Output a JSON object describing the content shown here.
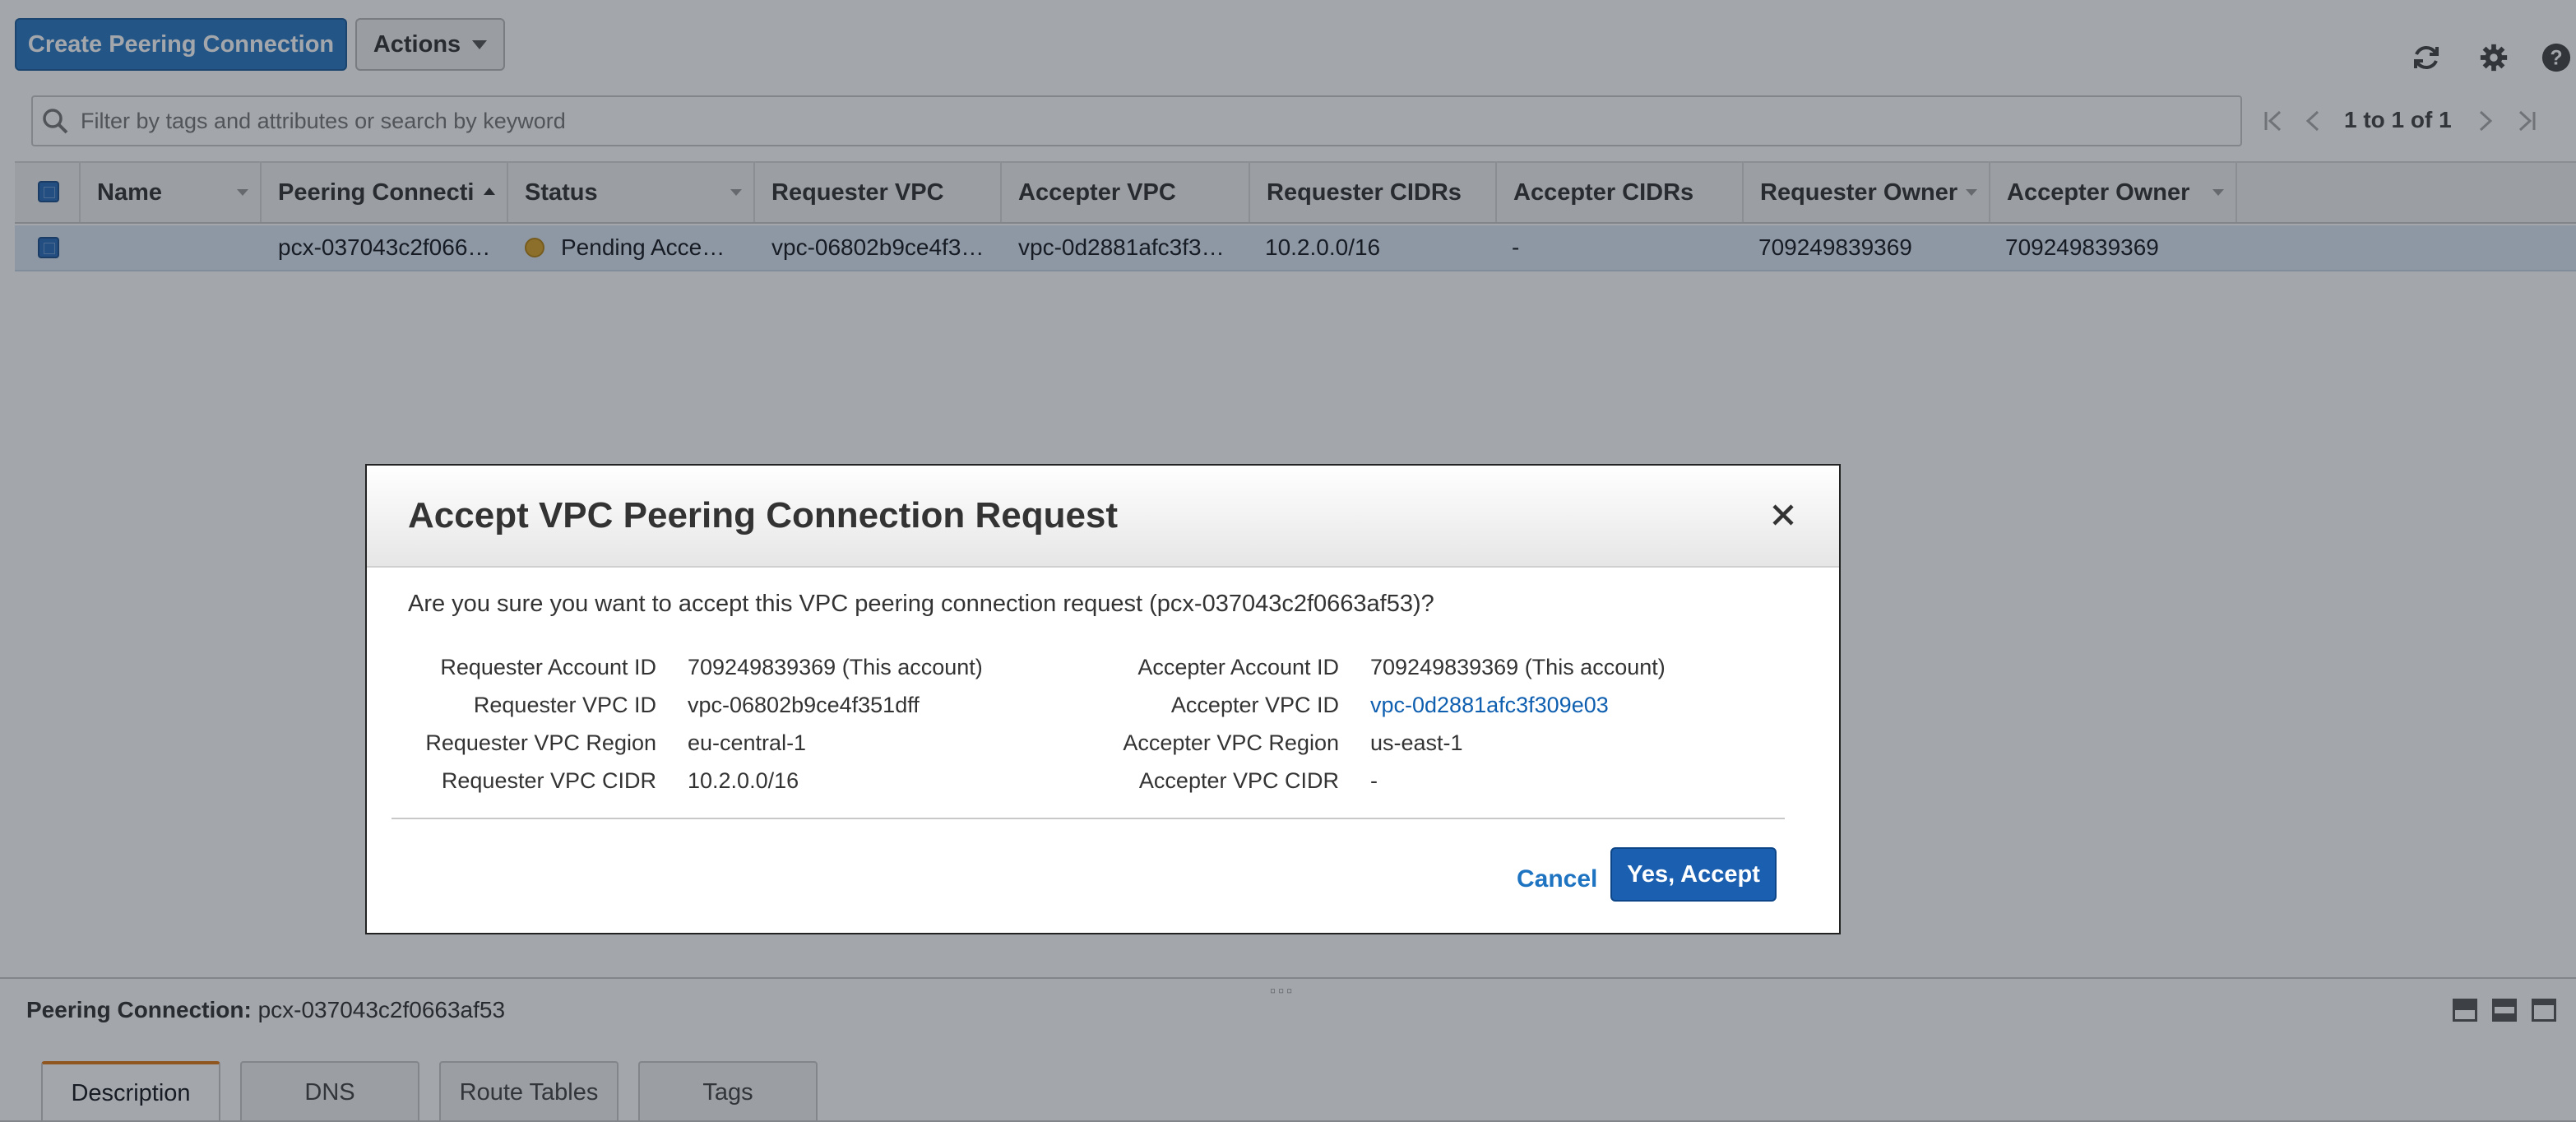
{
  "toolbar": {
    "create_label": "Create Peering Connection",
    "actions_label": "Actions"
  },
  "search": {
    "placeholder": "Filter by tags and attributes or search by keyword",
    "value": ""
  },
  "pagination": {
    "text": "1 to 1 of 1"
  },
  "table": {
    "columns": [
      "Name",
      "Peering Connecti",
      "Status",
      "Requester VPC",
      "Accepter VPC",
      "Requester CIDRs",
      "Accepter CIDRs",
      "Requester Owner",
      "Accepter Owner"
    ],
    "rows": [
      {
        "name": "",
        "peering_connection": "pcx-037043c2f066…",
        "status": "Pending Acce…",
        "requester_vpc": "vpc-06802b9ce4f3…",
        "accepter_vpc": "vpc-0d2881afc3f3…",
        "requester_cidrs": "10.2.0.0/16",
        "accepter_cidrs": "-",
        "requester_owner": "709249839369",
        "accepter_owner": "709249839369"
      }
    ]
  },
  "detail": {
    "label": "Peering Connection:",
    "value": "pcx-037043c2f0663af53",
    "tabs": [
      "Description",
      "DNS",
      "Route Tables",
      "Tags"
    ]
  },
  "modal": {
    "title": "Accept VPC Peering Connection Request",
    "question": "Are you sure you want to accept this VPC peering connection request (pcx-037043c2f0663af53)?",
    "requester": [
      {
        "label": "Requester Account ID",
        "value": "709249839369 (This account)"
      },
      {
        "label": "Requester VPC ID",
        "value": "vpc-06802b9ce4f351dff"
      },
      {
        "label": "Requester VPC Region",
        "value": "eu-central-1"
      },
      {
        "label": "Requester VPC CIDR",
        "value": "10.2.0.0/16"
      }
    ],
    "accepter": [
      {
        "label": "Accepter Account ID",
        "value": "709249839369 (This account)"
      },
      {
        "label": "Accepter VPC ID",
        "value": "vpc-0d2881afc3f309e03"
      },
      {
        "label": "Accepter VPC Region",
        "value": "us-east-1"
      },
      {
        "label": "Accepter VPC CIDR",
        "value": "-"
      }
    ],
    "cancel_label": "Cancel",
    "accept_label": "Yes, Accept"
  },
  "colors": {
    "primary": "#2a7bc4",
    "selected_row": "#dce8f5",
    "pending": "#d9a428",
    "link": "#0f5fb0",
    "tab_accent": "#e07b16"
  }
}
